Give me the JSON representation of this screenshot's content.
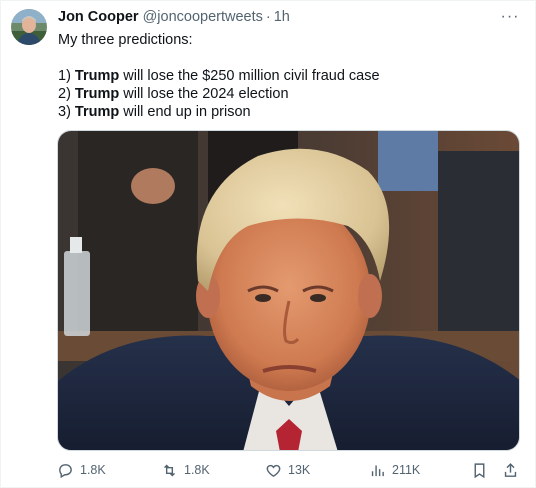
{
  "author": {
    "name": "Jon Cooper",
    "handle": "@joncoopertweets",
    "separator": "·",
    "time": "1h"
  },
  "more_label": "···",
  "tweet": {
    "intro": "My three predictions:",
    "predictions": [
      {
        "prefix": "1) ",
        "bold": "Trump",
        "rest": " will lose the $250 million civil fraud case"
      },
      {
        "prefix": "2) ",
        "bold": "Trump",
        "rest": " will lose the 2024 election"
      },
      {
        "prefix": "3) ",
        "bold": "Trump",
        "rest": " will end up in prison"
      }
    ]
  },
  "actions": {
    "replies": "1.8K",
    "reposts": "1.8K",
    "likes": "13K",
    "views": "211K"
  },
  "colors": {
    "text": "#0f1419",
    "muted": "#536471",
    "border": "#cfd9de"
  },
  "icons": {
    "reply": "reply-icon",
    "repost": "repost-icon",
    "like": "heart-icon",
    "views": "analytics-icon",
    "bookmark": "bookmark-icon",
    "share": "share-icon",
    "more": "more-icon"
  }
}
